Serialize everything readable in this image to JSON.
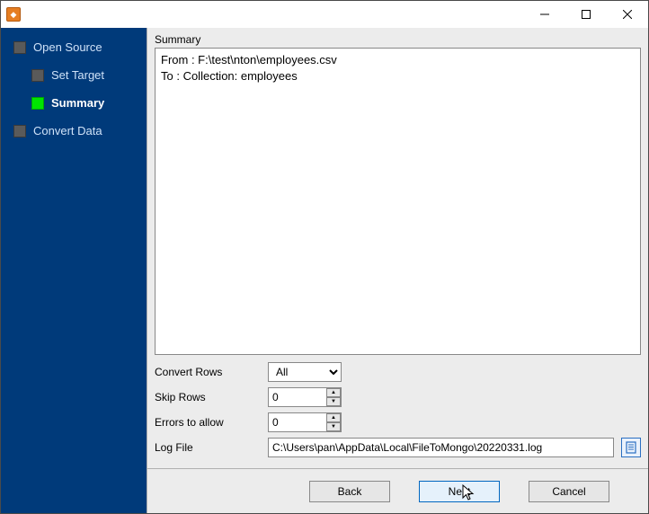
{
  "titlebar": {
    "icon_glyph": "◆"
  },
  "sidebar": {
    "steps": [
      {
        "label": "Open Source",
        "sub": false,
        "active": false
      },
      {
        "label": "Set Target",
        "sub": true,
        "active": false
      },
      {
        "label": "Summary",
        "sub": true,
        "active": true
      },
      {
        "label": "Convert Data",
        "sub": false,
        "active": false
      }
    ]
  },
  "summary": {
    "heading": "Summary",
    "text": "From : F:\\test\\nton\\employees.csv\nTo : Collection: employees"
  },
  "form": {
    "convert_rows": {
      "label": "Convert Rows",
      "value": "All",
      "options": [
        "All"
      ]
    },
    "skip_rows": {
      "label": "Skip Rows",
      "value": "0"
    },
    "errors_allow": {
      "label": "Errors to allow",
      "value": "0"
    },
    "log_file": {
      "label": "Log File",
      "value": "C:\\Users\\pan\\AppData\\Local\\FileToMongo\\20220331.log"
    }
  },
  "buttons": {
    "back": "Back",
    "next": "Next",
    "cancel": "Cancel"
  }
}
